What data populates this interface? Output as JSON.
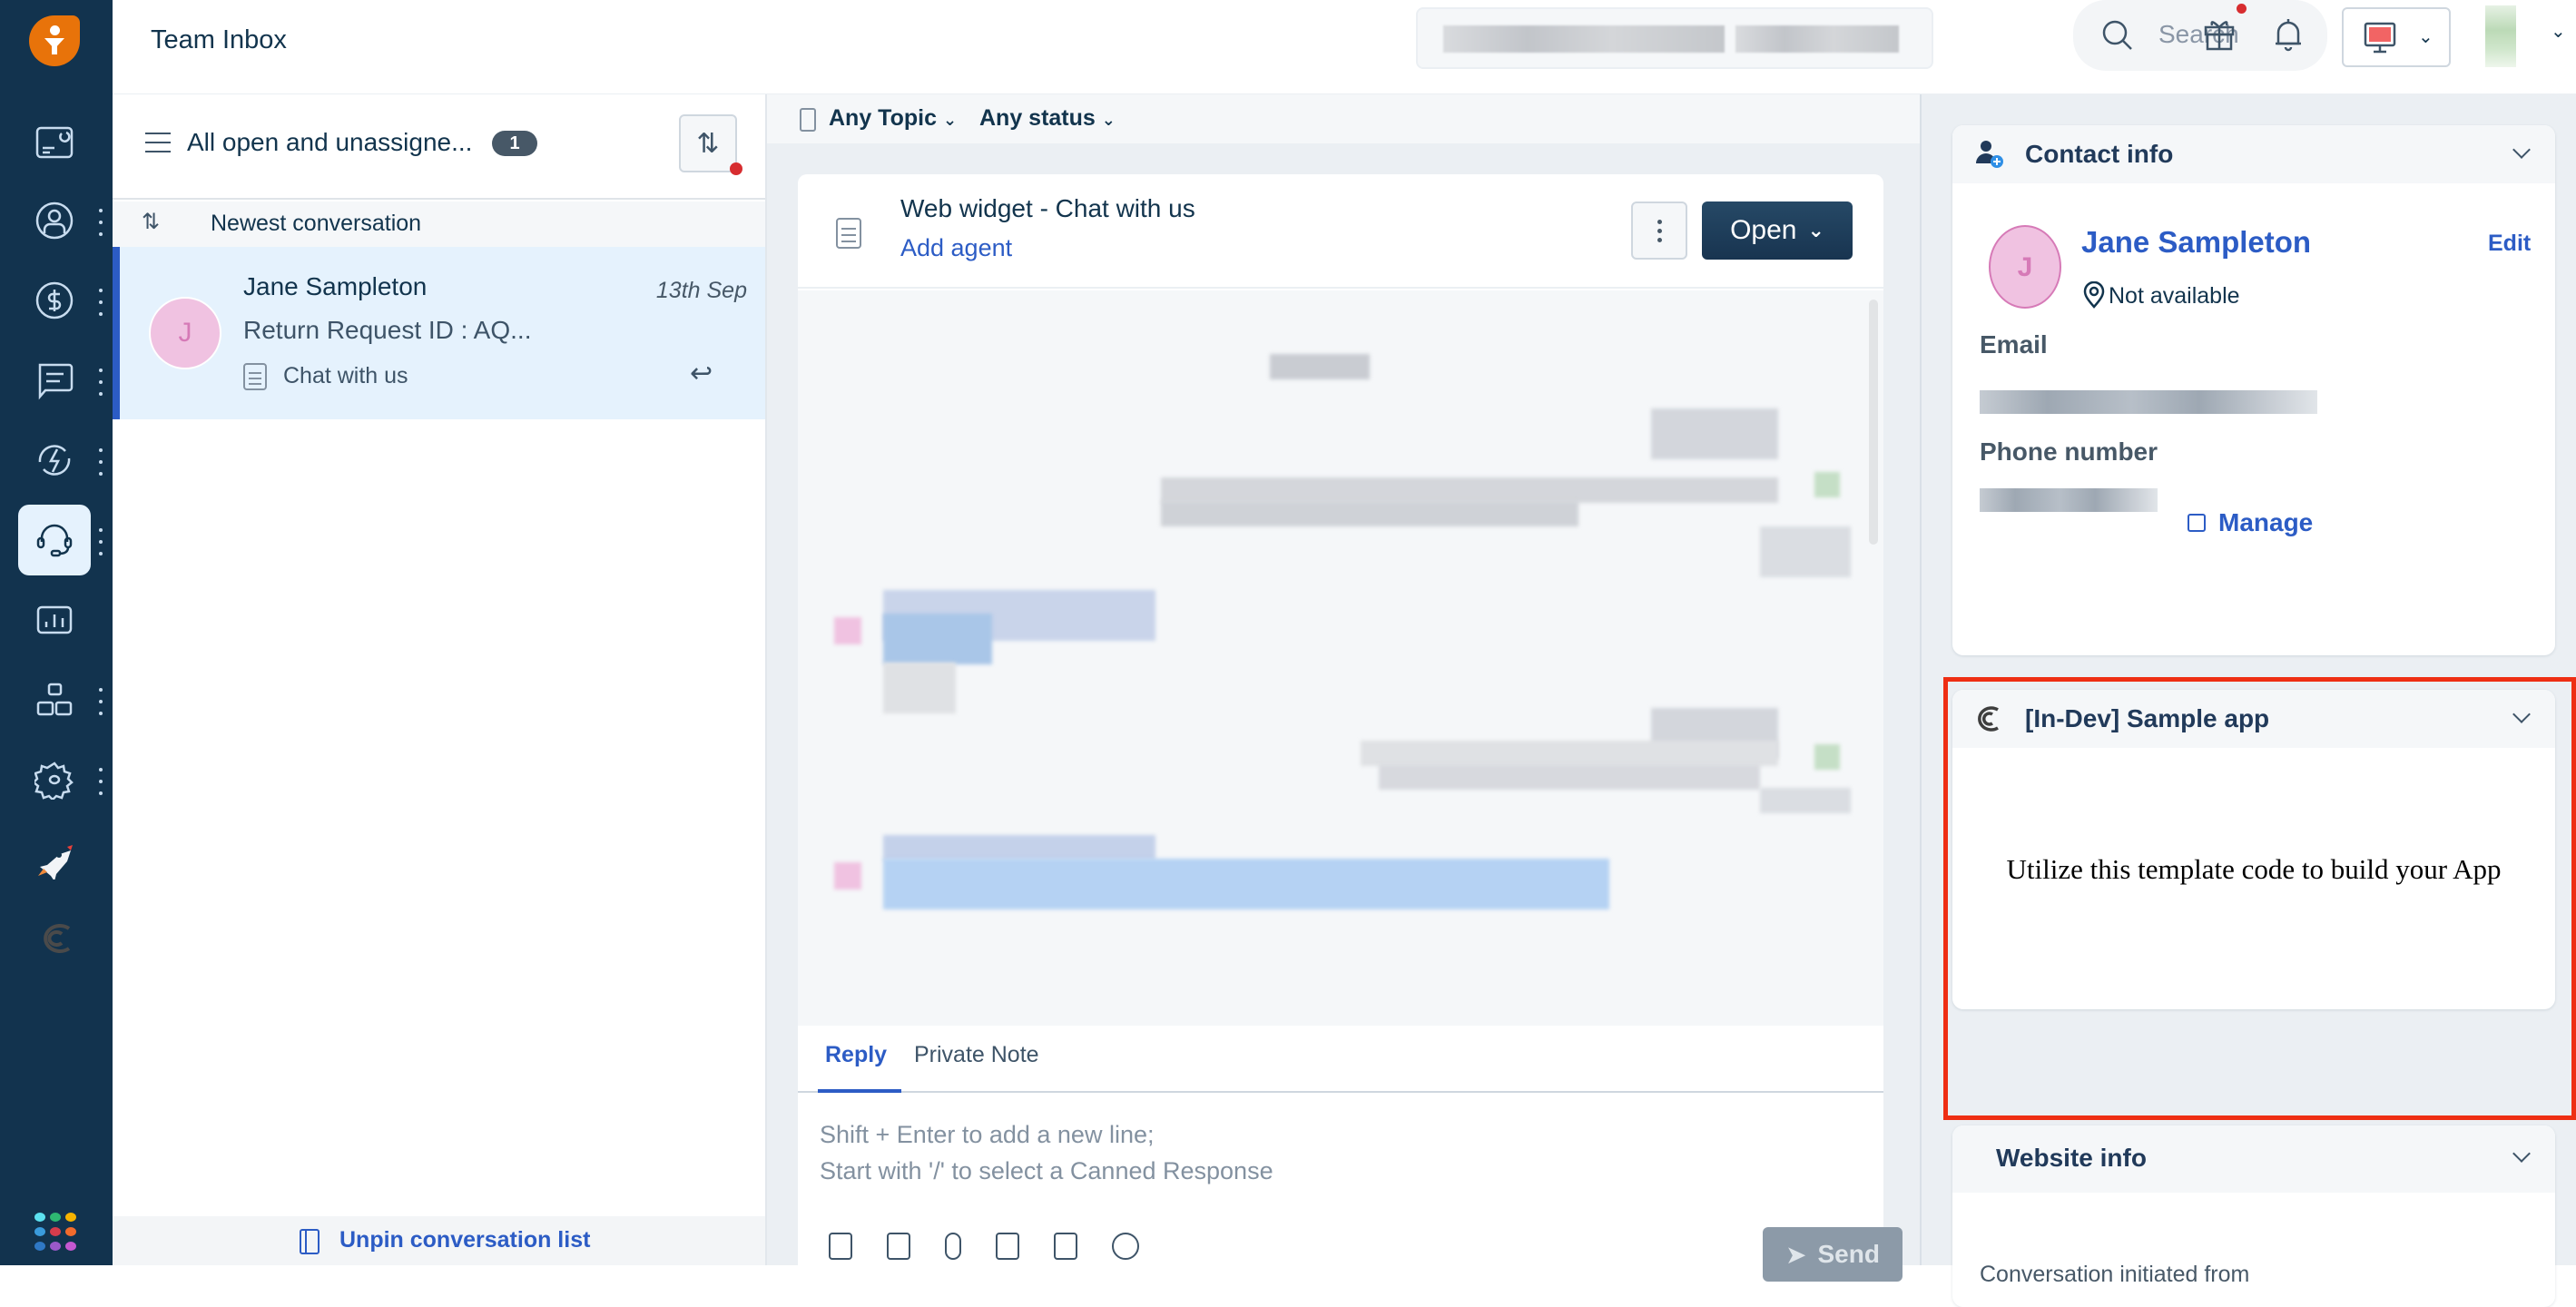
{
  "app": {
    "page_title": "Team Inbox"
  },
  "sidebar": {
    "items": [
      {
        "name": "dashboard",
        "icon": "dashboard-icon",
        "has_menu": false,
        "active": false
      },
      {
        "name": "contacts",
        "icon": "contact-icon",
        "has_menu": true,
        "active": false
      },
      {
        "name": "deals",
        "icon": "dollar-icon",
        "has_menu": true,
        "active": false
      },
      {
        "name": "conversations",
        "icon": "chat-icon",
        "has_menu": true,
        "active": false
      },
      {
        "name": "automations",
        "icon": "automation-icon",
        "has_menu": true,
        "active": false
      },
      {
        "name": "team-inbox",
        "icon": "headset-icon",
        "has_menu": true,
        "active": true
      },
      {
        "name": "analytics",
        "icon": "analytics-icon",
        "has_menu": false,
        "active": false
      },
      {
        "name": "admin",
        "icon": "blocks-icon",
        "has_menu": true,
        "active": false
      },
      {
        "name": "settings",
        "icon": "gear-icon",
        "has_menu": true,
        "active": false
      },
      {
        "name": "launch",
        "icon": "rocket-icon",
        "has_menu": false,
        "active": false
      },
      {
        "name": "app",
        "icon": "app-swirl-icon",
        "has_menu": false,
        "active": false
      }
    ],
    "apps_grid_colors": [
      "#5ce1f0",
      "#2eb872",
      "#f5b300",
      "#3a9bdc",
      "#d63c4c",
      "#f26b2c",
      "#2f78c4",
      "#9b59c9",
      "#c458d1"
    ]
  },
  "topbar": {
    "search_placeholder": "Search",
    "gift_has_notification": true
  },
  "conversation_list": {
    "view_title": "All open and unassigne...",
    "count": "1",
    "sort_label": "Newest conversation",
    "items": [
      {
        "initial": "J",
        "name": "Jane Sampleton",
        "date": "13th Sep",
        "preview": "Return Request ID : AQ...",
        "channel": "Chat with us"
      }
    ],
    "footer_label": "Unpin conversation list"
  },
  "chat": {
    "filters": {
      "topic": "Any Topic",
      "status": "Any status"
    },
    "header": {
      "title": "Web widget - Chat with us",
      "assign_label": "Add agent",
      "status_button": "Open"
    },
    "composer": {
      "tabs": [
        "Reply",
        "Private Note"
      ],
      "active_tab": "Reply",
      "placeholder_line1": "Shift + Enter to add a new line;",
      "placeholder_line2": "Start with '/' to select a Canned Response",
      "send_label": "Send",
      "toolbar_icons": [
        "canned-response-icon",
        "solution-article-icon",
        "attachment-icon",
        "image-icon",
        "calendar-icon",
        "emoji-icon"
      ]
    }
  },
  "right_panel": {
    "contact_info": {
      "title": "Contact info",
      "initial": "J",
      "name": "Jane Sampleton",
      "edit_label": "Edit",
      "location": "Not available",
      "email_label": "Email",
      "phone_label": "Phone number",
      "manage_label": "Manage"
    },
    "sample_app": {
      "title": "[In-Dev] Sample app",
      "body_text": "Utilize this template code to build your App"
    },
    "website_info": {
      "title": "Website info",
      "subtitle": "Conversation initiated from"
    }
  },
  "colors": {
    "sidebar_bg": "#12334e",
    "brand_orange": "#e8730a",
    "accent_blue": "#2c5cc5",
    "highlight_red": "#ee2e13",
    "notification_red": "#d72d30"
  }
}
